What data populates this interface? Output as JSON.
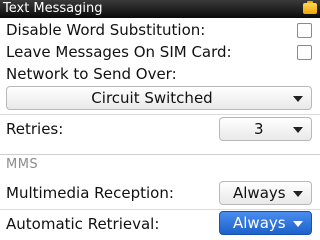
{
  "titlebar": {
    "title": "Text Messaging"
  },
  "settings": {
    "disable_word_substitution": {
      "label": "Disable Word Substitution:",
      "checked": false
    },
    "leave_on_sim": {
      "label": "Leave Messages On SIM Card:",
      "checked": false
    },
    "network": {
      "label": "Network to Send Over:",
      "value": "Circuit Switched"
    },
    "retries": {
      "label": "Retries:",
      "value": "3"
    }
  },
  "mms": {
    "header": "MMS",
    "multimedia_reception": {
      "label": "Multimedia Reception:",
      "value": "Always"
    },
    "automatic_retrieval": {
      "label": "Automatic Retrieval:",
      "value": "Always"
    }
  },
  "colors": {
    "selection": "#1d62c9",
    "battery": "#f0a800"
  }
}
